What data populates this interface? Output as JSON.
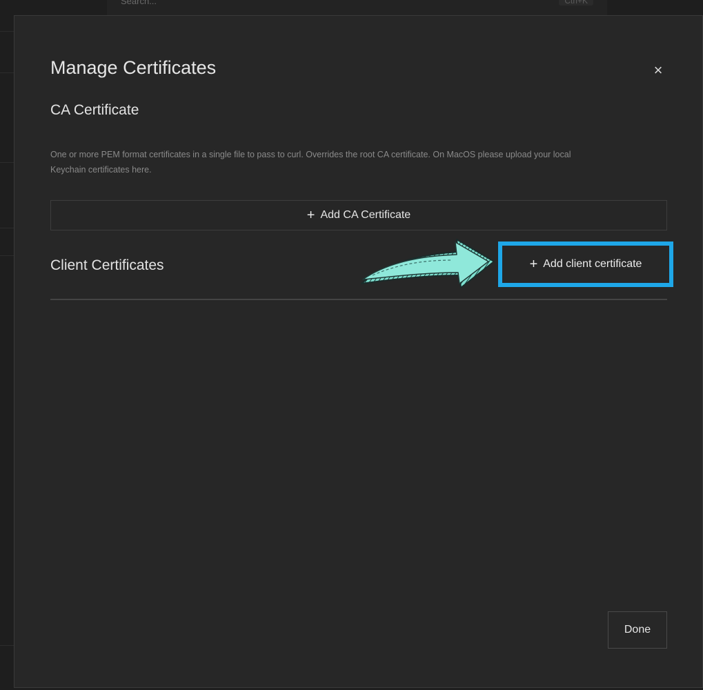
{
  "header": {
    "search_placeholder": "Search...",
    "shortcut": "Ctrl+K"
  },
  "modal": {
    "title": "Manage Certificates",
    "close_symbol": "×",
    "ca_section": {
      "title": "CA Certificate",
      "description": "One or more PEM format certificates in a single file to pass to curl. Overrides the root CA certificate. On MacOS please upload your local Keychain certificates here.",
      "add_button_icon": "+",
      "add_button_label": "Add CA Certificate"
    },
    "client_section": {
      "title": "Client Certificates",
      "add_button_icon": "+",
      "add_button_label": "Add client certificate"
    },
    "done_label": "Done"
  },
  "annotation": {
    "arrow_icon": "curved-arrow-icon",
    "highlight_color": "#1ea7e8",
    "arrow_color": "#7ee0d0"
  }
}
